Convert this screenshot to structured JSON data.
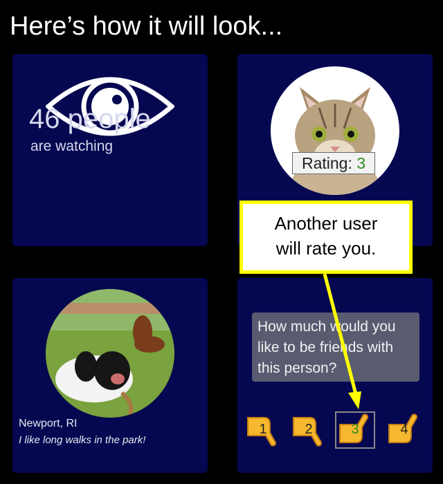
{
  "heading": "Here’s how it will look...",
  "watching": {
    "count": "46 people",
    "sub": "are watching"
  },
  "rating": {
    "label": "Rating:",
    "value": "3"
  },
  "profile": {
    "location": "Newport, RI",
    "bio": "I like long walks in the park!"
  },
  "question": {
    "text": "How much would you like to be friends with this person?"
  },
  "scale": [
    "1",
    "2",
    "3",
    "4"
  ],
  "selected_value": "3",
  "callout": {
    "line1": "Another user",
    "line2": "will rate you."
  },
  "colors": {
    "panel": "#050750",
    "callout_border": "#ffff00",
    "rating_green": "#2e8b22",
    "thumb": "#f5b82e"
  }
}
